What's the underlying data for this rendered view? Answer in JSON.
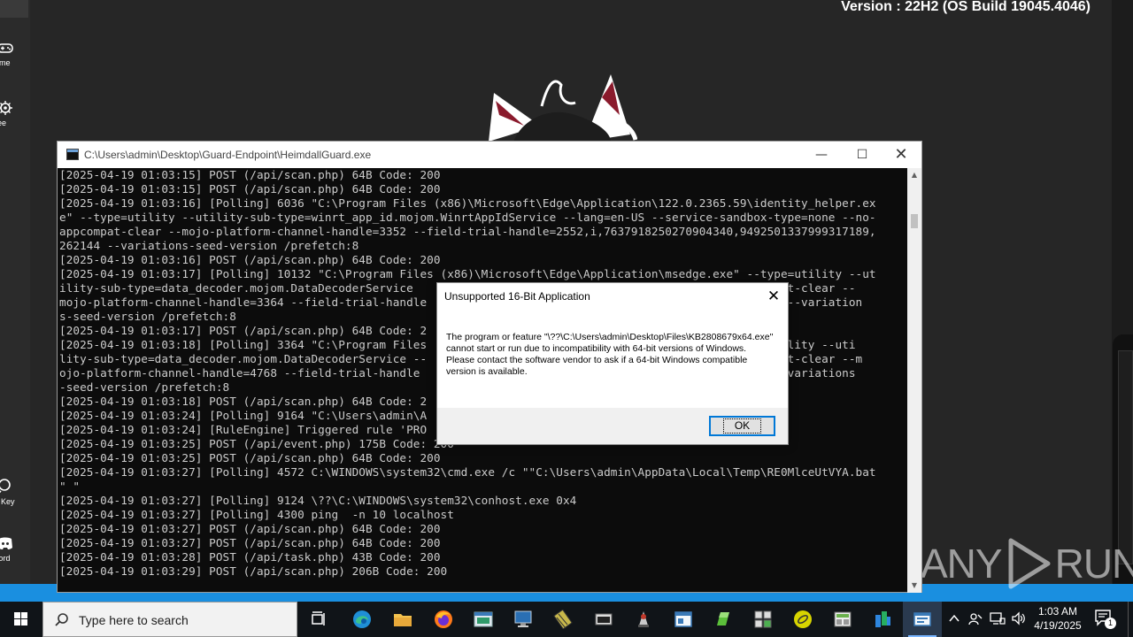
{
  "desktop": {
    "version_text": "Version : 22H2 (OS Build 19045.4046)",
    "left_apps": [
      {
        "label": "ame",
        "icon": "gamepad-icon"
      },
      {
        "label": "ree",
        "icon": "gear-icon"
      },
      {
        "label": "y Key",
        "icon": "key-icon"
      },
      {
        "label": "cord",
        "icon": "discord-icon"
      }
    ],
    "watermark": {
      "left": "ANY",
      "right": "RUN"
    }
  },
  "console": {
    "title": "C:\\Users\\admin\\Desktop\\Guard-Endpoint\\HeimdallGuard.exe",
    "lines": [
      "[2025-04-19 01:03:15] POST (/api/scan.php) 64B Code: 200",
      "[2025-04-19 01:03:15] POST (/api/scan.php) 64B Code: 200",
      "[2025-04-19 01:03:16] [Polling] 6036 \"C:\\Program Files (x86)\\Microsoft\\Edge\\Application\\122.0.2365.59\\identity_helper.ex",
      "e\" --type=utility --utility-sub-type=winrt_app_id.mojom.WinrtAppIdService --lang=en-US --service-sandbox-type=none --no-",
      "appcompat-clear --mojo-platform-channel-handle=3352 --field-trial-handle=2552,i,7637918250270904340,9492501337999317189,",
      "262144 --variations-seed-version /prefetch:8",
      "[2025-04-19 01:03:16] POST (/api/scan.php) 64B Code: 200",
      "[2025-04-19 01:03:17] [Polling] 10132 \"C:\\Program Files (x86)\\Microsoft\\Edge\\Application\\msedge.exe\" --type=utility --ut",
      "ility-sub-type=data_decoder.mojom.DataDecoderService                                                 pcompat-clear --",
      "mojo-platform-channel-handle=3364 --field-trial-handle                                               52144 --variation",
      "s-seed-version /prefetch:8",
      "[2025-04-19 01:03:17] POST (/api/scan.php) 64B Code: 2",
      "[2025-04-19 01:03:18] [Polling] 3364 \"C:\\Program Files                                              ype=utility --uti",
      "lity-sub-type=data_decoder.mojom.DataDecoderService --                                              opcompat-clear --m",
      "ojo-platform-channel-handle=4768 --field-trial-handle                                               2144 --variations",
      "-seed-version /prefetch:8",
      "[2025-04-19 01:03:18] POST (/api/scan.php) 64B Code: 2",
      "[2025-04-19 01:03:24] [Polling] 9164 \"C:\\Users\\admin\\A",
      "[2025-04-19 01:03:24] [RuleEngine] Triggered rule 'PRO",
      "[2025-04-19 01:03:25] POST (/api/event.php) 175B Code: 200",
      "[2025-04-19 01:03:25] POST (/api/scan.php) 64B Code: 200",
      "[2025-04-19 01:03:27] [Polling] 4572 C:\\WINDOWS\\system32\\cmd.exe /c \"\"C:\\Users\\admin\\AppData\\Local\\Temp\\RE0MlceUtVYA.bat",
      "\" \"",
      "[2025-04-19 01:03:27] [Polling] 9124 \\??\\C:\\WINDOWS\\system32\\conhost.exe 0x4",
      "[2025-04-19 01:03:27] [Polling] 4300 ping  -n 10 localhost",
      "[2025-04-19 01:03:27] POST (/api/scan.php) 64B Code: 200",
      "[2025-04-19 01:03:27] POST (/api/scan.php) 64B Code: 200",
      "[2025-04-19 01:03:28] POST (/api/task.php) 43B Code: 200",
      "[2025-04-19 01:03:29] POST (/api/scan.php) 206B Code: 200"
    ]
  },
  "dialog": {
    "title": "Unsupported 16-Bit Application",
    "message": "The program or feature \"\\??\\C:\\Users\\admin\\Desktop\\Files\\KB2808679x64.exe\" cannot start or run due to incompatibility with 64-bit versions of Windows. Please contact the software vendor to ask if a 64-bit Windows compatible version is available.",
    "ok_label": "OK"
  },
  "taskbar": {
    "search_placeholder": "Type here to search",
    "time": "1:03 AM",
    "date": "4/19/2025",
    "notification_count": "1",
    "pinned": [
      {
        "name": "task-view-icon"
      },
      {
        "name": "edge-icon"
      },
      {
        "name": "file-explorer-icon"
      },
      {
        "name": "firefox-icon"
      },
      {
        "name": "app-window-icon"
      },
      {
        "name": "remote-desktop-icon"
      },
      {
        "name": "chip-icon"
      },
      {
        "name": "console-icon"
      },
      {
        "name": "tool-icon"
      },
      {
        "name": "window-app-icon"
      },
      {
        "name": "green-app-icon"
      },
      {
        "name": "network-app-icon"
      },
      {
        "name": "yellow-disc-icon"
      },
      {
        "name": "calculator-icon"
      },
      {
        "name": "blue-flag-icon"
      },
      {
        "name": "active-console-icon"
      }
    ],
    "colors": {
      "accent": "#0078d7",
      "band": "#1a8fe0"
    }
  }
}
